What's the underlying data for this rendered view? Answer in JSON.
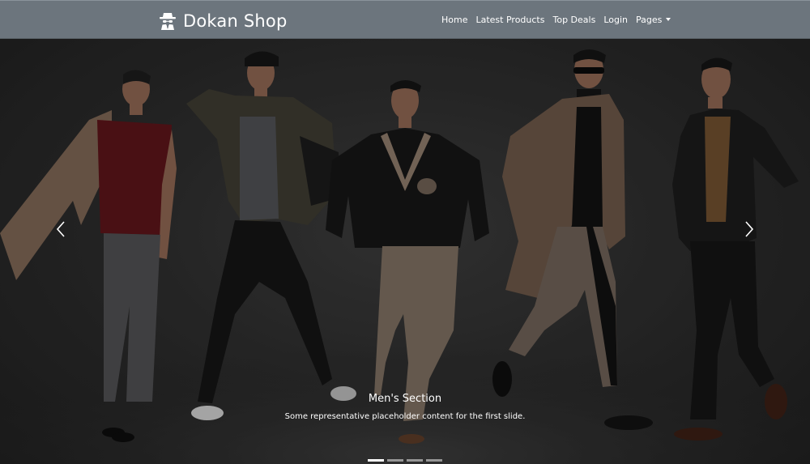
{
  "brand": {
    "name": "Dokan Shop",
    "icon": "detective-icon"
  },
  "nav": {
    "items": [
      {
        "label": "Home"
      },
      {
        "label": "Latest Products"
      },
      {
        "label": "Top Deals"
      },
      {
        "label": "Login"
      },
      {
        "label": "Pages",
        "dropdown": true
      }
    ]
  },
  "carousel": {
    "caption_title": "Men's Section",
    "caption_text": "Some representative placeholder content for the first slide.",
    "active_slide": 0,
    "slide_count": 4,
    "prev_icon": "chevron-left-icon",
    "next_icon": "chevron-right-icon"
  },
  "colors": {
    "navbar": "#6c757d",
    "background": "#2b2b2b",
    "text": "#ffffff"
  }
}
